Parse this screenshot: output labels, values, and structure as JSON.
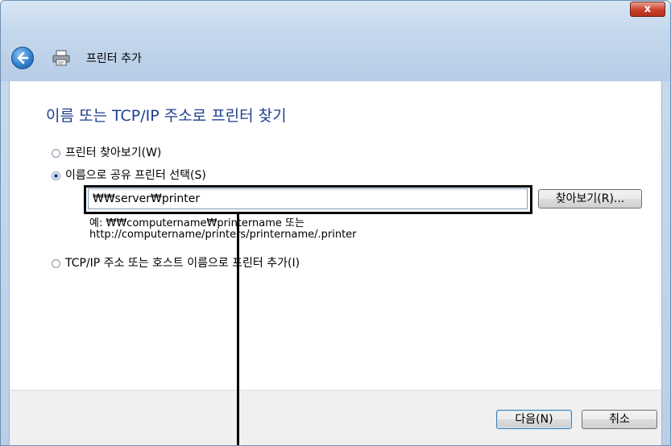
{
  "window": {
    "close_label": "x"
  },
  "header": {
    "title": "프린터 추가"
  },
  "main": {
    "title": "이름 또는 TCP/IP 주소로 프린터 찾기",
    "options": [
      {
        "label": "프린터 찾아보기(W)",
        "selected": false
      },
      {
        "label": "이름으로 공유 프린터 선택(S)",
        "selected": true
      },
      {
        "label": "TCP/IP 주소 또는 호스트 이름으로 프린터 추가(I)",
        "selected": false
      }
    ],
    "path_value": "₩₩server₩printer",
    "browse_label": "찾아보기(R)...",
    "example_line1": "예: ₩₩computername₩printername 또는",
    "example_line2": "http://computername/printers/printername/.printer"
  },
  "footer": {
    "next_label": "다음(N)",
    "cancel_label": "취소"
  }
}
